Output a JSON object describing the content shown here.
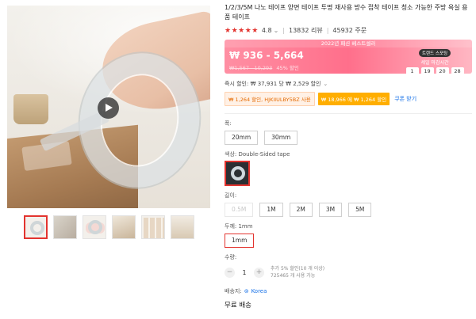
{
  "product": {
    "title": "1/2/3/5M 나노 테이프 양면 테이프 투명 재사용 방수 접착 테이프 청소 가능한 주방 욕실 용품 테이프",
    "rating": "4.8",
    "rating_chevron": "⌄",
    "reviews": "13832 리뷰",
    "orders": "45932 주문",
    "stars": "★★★★★"
  },
  "price": {
    "banner_title": "2022년 패션 베스트셀러",
    "range": "₩ 936 - 5,664",
    "original": "₩1,567 - 10,293",
    "discount": "45% 할인",
    "countdown_badge": "트렌드 스포팅",
    "countdown_label": "세일 마감시간",
    "countdown": [
      "1",
      "19",
      "20",
      "28"
    ]
  },
  "promo": {
    "instant_label": "즉시 할인: ₩ 37,931 당 ₩ 2,529 할인",
    "instant_chevron": "⌄",
    "coupon1": "₩ 1,264 할인, HJKIIULBY5BZ 사용",
    "coupon2": "₩ 18,966 에 ₩ 1,264 할인",
    "coupon_link": "쿠폰 받기"
  },
  "options": {
    "width_label": "폭:",
    "widths": [
      "20mm",
      "30mm"
    ],
    "color_label": "색상: Double-Sided tape",
    "length_label": "길이:",
    "lengths": [
      "0.5M",
      "1M",
      "2M",
      "3M",
      "5M"
    ],
    "thickness_label": "두께: 1mm",
    "thickness": "1mm"
  },
  "quantity": {
    "label": "수량:",
    "value": "1",
    "minus": "−",
    "plus": "+",
    "note1": "추가 5% 할인(10 개 이상)",
    "note2": "725465 개 사용 가능"
  },
  "shipping": {
    "label": "배송지:",
    "location": "Korea",
    "pin": "⊚",
    "free": "무료 배송"
  },
  "colors": {
    "accent": "#e3342f",
    "banner": "#ff6f8b",
    "link": "#1a73e8"
  }
}
